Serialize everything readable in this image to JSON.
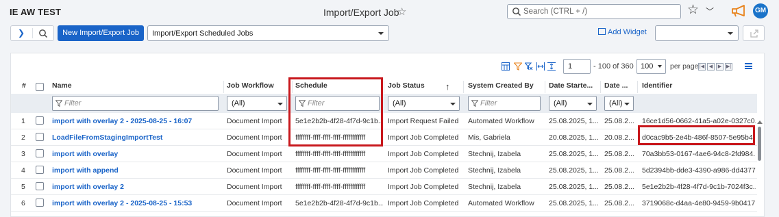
{
  "app": {
    "title": "IE AW TEST",
    "page_title": "Import/Export Job",
    "user_initials": "GM"
  },
  "search": {
    "placeholder": "Search (CTRL + /)"
  },
  "toolbar": {
    "new_button": "New Import/Export Job",
    "view_select": "Import/Export Scheduled Jobs",
    "add_widget": "Add Widget",
    "widget_select": ""
  },
  "pager": {
    "page": "1",
    "range": "- 100 of 360",
    "per_page": "100",
    "per_page_label": "per page"
  },
  "columns": {
    "num": "#",
    "name": "Name",
    "workflow": "Job Workflow",
    "schedule": "Schedule",
    "status": "Job Status",
    "created_by": "System Created By",
    "date_started": "Date Starte...",
    "date_2": "Date ...",
    "identifier": "Identifier"
  },
  "filters": {
    "name_placeholder": "Filter",
    "workflow": "(All)",
    "schedule_placeholder": "Filter",
    "status": "(All)",
    "created_by_placeholder": "Filter",
    "date_started": "(All)",
    "date_2": "(All)"
  },
  "rows": [
    {
      "num": "1",
      "name": "import with overlay 2 - 2025-08-25 - 16:07",
      "workflow": "Document Import",
      "schedule": "5e1e2b2b-4f28-4f7d-9c1b...",
      "status": "Import Request Failed",
      "created_by": "Automated Workflow",
      "date_started": "25.08.2025, 1...",
      "date_2": "25.08.2...",
      "identifier": "16ce1d56-0662-41a5-a02e-0327c0..."
    },
    {
      "num": "2",
      "name": "LoadFileFromStagingImportTest",
      "workflow": "Document Import",
      "schedule": "ffffffff-ffff-ffff-ffff-ffffffffffff",
      "status": "Import Job Completed",
      "created_by": "Mis, Gabriela",
      "date_started": "20.08.2025, 1...",
      "date_2": "20.08.2...",
      "identifier": "d0cac9b5-2e4b-486f-8507-5e95b4..."
    },
    {
      "num": "3",
      "name": "import with overlay",
      "workflow": "Document Import",
      "schedule": "ffffffff-ffff-ffff-ffff-ffffffffffff",
      "status": "Import Job Completed",
      "created_by": "Stechnij, Izabela",
      "date_started": "25.08.2025, 1...",
      "date_2": "25.08.2...",
      "identifier": "70a3bb53-0167-4ae6-94c8-2fd984..."
    },
    {
      "num": "4",
      "name": "import with append",
      "workflow": "Document Import",
      "schedule": "ffffffff-ffff-ffff-ffff-ffffffffffff",
      "status": "Import Job Completed",
      "created_by": "Stechnij, Izabela",
      "date_started": "25.08.2025, 1...",
      "date_2": "25.08.2...",
      "identifier": "5d2394bb-dde3-4390-a986-dd4377..."
    },
    {
      "num": "5",
      "name": "import with overlay 2",
      "workflow": "Document Import",
      "schedule": "ffffffff-ffff-ffff-ffff-ffffffffffff",
      "status": "Import Job Completed",
      "created_by": "Stechnij, Izabela",
      "date_started": "25.08.2025, 1...",
      "date_2": "25.08.2...",
      "identifier": "5e1e2b2b-4f28-4f7d-9c1b-7024f3c..."
    },
    {
      "num": "6",
      "name": "import with overlay 2 - 2025-08-25 - 15:53",
      "workflow": "Document Import",
      "schedule": "5e1e2b2b-4f28-4f7d-9c1b...",
      "status": "Import Job Completed",
      "created_by": "Automated Workflow",
      "date_started": "25.08.2025, 1...",
      "date_2": "25.08.2...",
      "identifier": "3719068c-d4aa-4e80-9459-9b0417..."
    }
  ],
  "colors": {
    "accent": "#1a64c8",
    "highlight": "#c8171c",
    "header_bg": "#f2f4f7"
  }
}
